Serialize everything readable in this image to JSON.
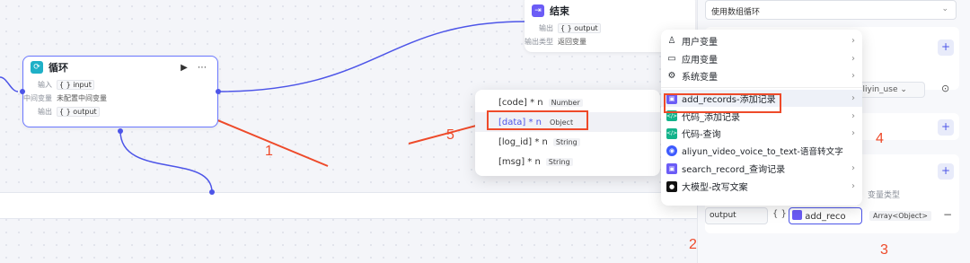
{
  "loop_node": {
    "title": "循环",
    "actions": "▶ ⋯",
    "input_label": "输入",
    "input_value": "input",
    "intermediate_label": "中间变量",
    "intermediate_value": "未配置中间变量",
    "output_label": "输出",
    "output_value": "output"
  },
  "end_node": {
    "title": "结束",
    "output_label": "输出",
    "output_value": "output",
    "output_type_label": "输出类型",
    "output_type_value": "返回变量"
  },
  "vars_menu": {
    "items": [
      {
        "icon": "user-icon",
        "glyph": "♙",
        "label": "用户变量",
        "color": "#333333"
      },
      {
        "icon": "folder-icon",
        "glyph": "▭",
        "label": "应用变量",
        "color": "#333333"
      },
      {
        "icon": "gear-icon",
        "glyph": "⚙",
        "label": "系统变量",
        "color": "#333333"
      },
      {
        "icon": "plugin-icon",
        "glyph": "▣",
        "label": "add_records-添加记录",
        "color": "#6b5cf6"
      },
      {
        "icon": "code-icon",
        "glyph": "</>",
        "label": "代码_添加记录",
        "color": "#13b38b"
      },
      {
        "icon": "code-icon",
        "glyph": "</>",
        "label": "代码-查询",
        "color": "#13b38b"
      },
      {
        "icon": "plugin-icon",
        "glyph": "◉",
        "label": "aliyun_video_voice_to_text-语音转文字",
        "color": "#3d5afe"
      },
      {
        "icon": "plugin-icon",
        "glyph": "▣",
        "label": "search_record_查询记录",
        "color": "#6b5cf6"
      },
      {
        "icon": "llm-icon",
        "glyph": "●",
        "label": "大模型-改写文案",
        "color": "#111111"
      }
    ]
  },
  "fields_menu": {
    "items": [
      {
        "name": "[code] * n",
        "type": "Number"
      },
      {
        "name": "[data] * n",
        "type": "Object"
      },
      {
        "name": "[log_id] * n",
        "type": "String"
      },
      {
        "name": "[msg] * n",
        "type": "String"
      }
    ]
  },
  "panel": {
    "mode_select": "使用数组循环",
    "partial_value": "aliyin_use",
    "var_type_header": "变量类型",
    "output_name": "output",
    "braces": "{ }",
    "ref_value": "add_reco",
    "ref_type": "Array<Object>",
    "remove": "−",
    "plus": "+"
  },
  "annotations": {
    "n1": "1",
    "n2": "2",
    "n3": "3",
    "n4": "4",
    "n5": "5",
    "color": "#ee4a2a"
  }
}
